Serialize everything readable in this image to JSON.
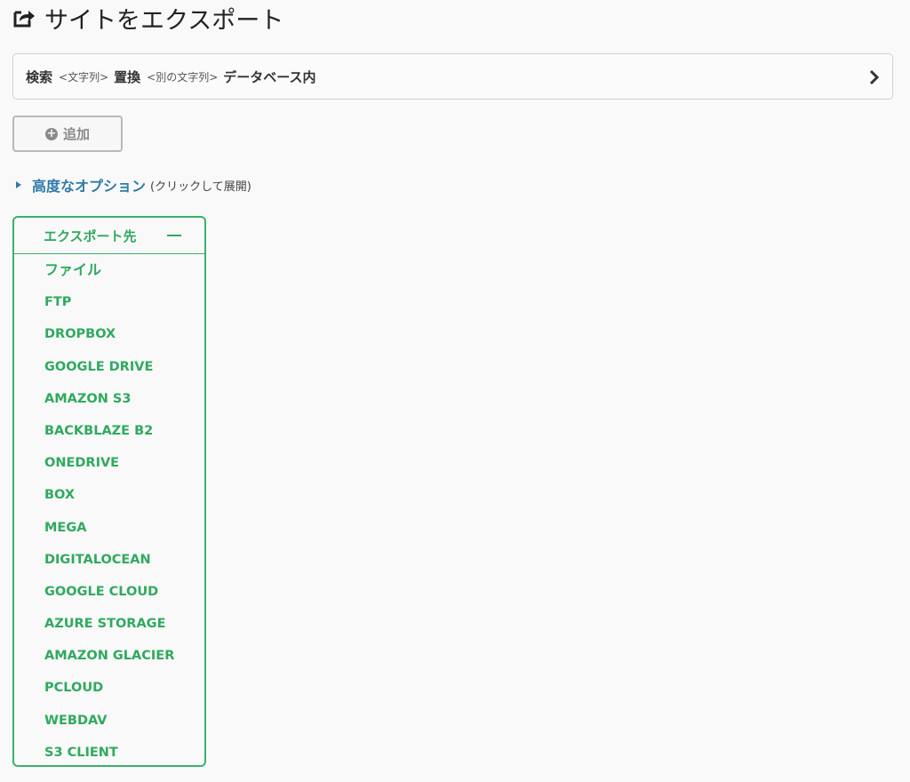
{
  "page": {
    "title": "サイトをエクスポート",
    "title_icon": "share-square-icon"
  },
  "search_bar": {
    "search_label": "検索",
    "search_placeholder": "<文字列>",
    "replace_label": "置換",
    "replace_placeholder": "<別の文字列>",
    "scope_label": "データベース内",
    "expand_icon": "chevron-right-icon"
  },
  "add_button": {
    "label": "追加",
    "icon": "plus-circle-icon"
  },
  "advanced_options": {
    "link_label": "高度なオプション",
    "hint": "(クリックして展開)"
  },
  "export_to": {
    "header": "エクスポート先",
    "collapse_icon": "minus-icon",
    "accent_color": "#2faa5e",
    "destinations": [
      "ファイル",
      "FTP",
      "DROPBOX",
      "GOOGLE DRIVE",
      "AMAZON S3",
      "BACKBLAZE B2",
      "ONEDRIVE",
      "BOX",
      "MEGA",
      "DIGITALOCEAN",
      "GOOGLE CLOUD",
      "AZURE STORAGE",
      "AMAZON GLACIER",
      "PCLOUD",
      "WEBDAV",
      "S3 CLIENT"
    ]
  }
}
